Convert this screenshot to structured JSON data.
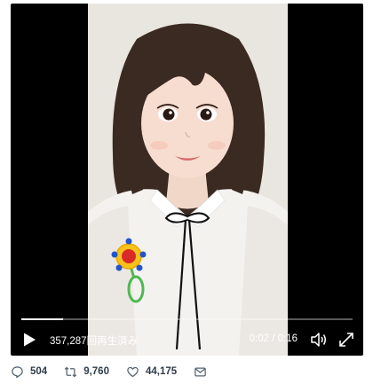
{
  "player": {
    "view_count_label": "357,287回再生済み",
    "time_label": "0:02 / 0:16",
    "progress_fraction": 0.125
  },
  "actions": {
    "reply_count": "504",
    "retweet_count": "9,760",
    "like_count": "44,175"
  },
  "icons": {
    "play": "play-icon",
    "volume": "volume-icon",
    "fullscreen": "fullscreen-icon",
    "reply": "reply-icon",
    "retweet": "retweet-icon",
    "like": "heart-icon",
    "share": "share-icon"
  },
  "colors": {
    "action_icon": "#536471",
    "video_bg": "#000000"
  }
}
